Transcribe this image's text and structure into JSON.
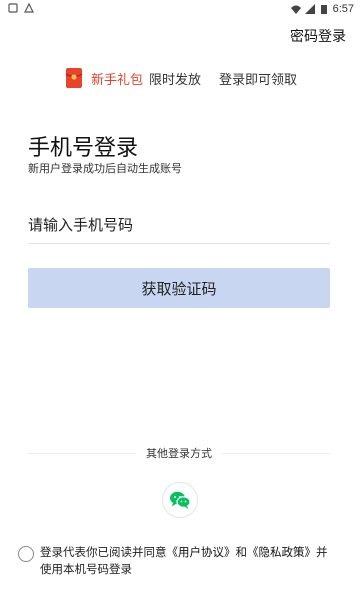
{
  "status_bar": {
    "time": "6:57"
  },
  "header": {
    "password_login": "密码登录"
  },
  "gift": {
    "title": "新手礼包",
    "limited": "限时发放",
    "claim": "登录即可领取"
  },
  "main": {
    "title": "手机号登录",
    "subtitle": "新用户登录成功后自动生成账号",
    "phone_placeholder": "请输入手机号码",
    "get_code_label": "获取验证码"
  },
  "other_login": {
    "label": "其他登录方式"
  },
  "agreement": {
    "prefix": "登录代表你已阅读并同意",
    "user_agreement": "《用户协议》",
    "and": "和",
    "privacy_policy": "《隐私政策》",
    "suffix": "并使用本机号码登录"
  },
  "colors": {
    "accent_red": "#e8432d",
    "button_bg": "#c9d6f2",
    "wechat_green": "#07c160"
  }
}
